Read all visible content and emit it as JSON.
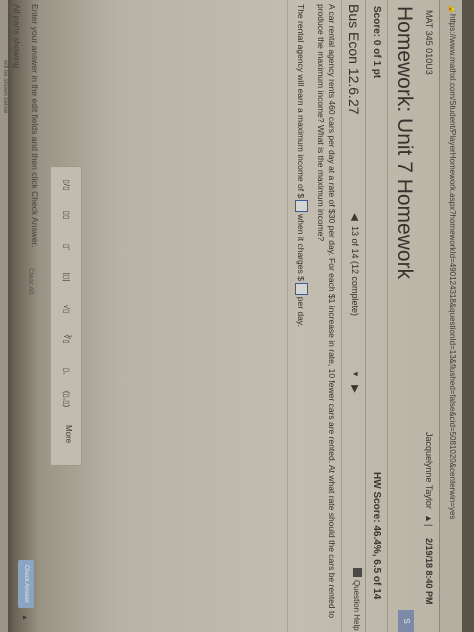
{
  "browser": {
    "url": "https://www.mathxl.com/Student/PlayerHomework.aspx?homeworkId=490124318&questionId=13&flushed=false&cid=5081020&centerwin=yes"
  },
  "header": {
    "course": "MAT 345 010U3",
    "user": "Jacquelynne Taylor",
    "separator": "|",
    "datetime": "2/19/18 8:40 PM",
    "side_tab": "S"
  },
  "homework": {
    "title": "Homework: Unit 7 Homework",
    "score_label": "Score: 0 of 1 pt",
    "hw_score": "HW Score: 46.4%, 6.5 of 14"
  },
  "question": {
    "id": "Bus Econ 12.6.27",
    "nav_label": "13 of 14 (12 complete)",
    "help_label": "Question Help",
    "problem_line1": "A car rental agency rents 460 cars per day at a rate of $30 per day. For each $1 increase in rate, 10 fewer cars are rented. At what rate should the cars be rented to",
    "problem_line2": "produce the maximum income? What is the maximum income?",
    "answer_prefix": "The rental agency will earn a maximum income of $",
    "answer_middle": "when it charges $",
    "answer_suffix": "per day."
  },
  "toolbar": {
    "buttons": [
      "▯/▯",
      "▯▯",
      "▯'",
      "|▯|",
      "√▯",
      "∛▯",
      "▯,",
      "(▯,▯)"
    ],
    "more_label": "More"
  },
  "footer": {
    "instruction": "Enter your answer in the edit fields and then click Check Answer.",
    "all_parts": "All parts showing",
    "clear_all": "Clear All",
    "check_answer": "Check Answer",
    "shown_below": "will be shown below"
  }
}
